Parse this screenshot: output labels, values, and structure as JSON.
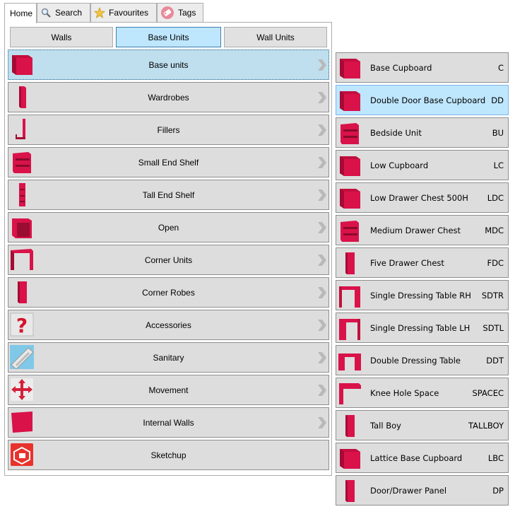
{
  "tabs": [
    {
      "label": "Home",
      "icon": ""
    },
    {
      "label": "Search",
      "icon": "magnifier-icon"
    },
    {
      "label": "Favourites",
      "icon": "star-icon"
    },
    {
      "label": "Tags",
      "icon": "tag-icon"
    }
  ],
  "segments": {
    "walls": "Walls",
    "base_units": "Base Units",
    "wall_units": "Wall Units"
  },
  "categories": [
    {
      "label": "Base units",
      "icon": "base-cabinet-icon"
    },
    {
      "label": "Wardrobes",
      "icon": "wardrobe-icon"
    },
    {
      "label": "Fillers",
      "icon": "filler-icon"
    },
    {
      "label": "Small End Shelf",
      "icon": "small-end-shelf-icon"
    },
    {
      "label": "Tall End Shelf",
      "icon": "tall-end-shelf-icon"
    },
    {
      "label": "Open",
      "icon": "open-unit-icon"
    },
    {
      "label": "Corner Units",
      "icon": "corner-unit-icon"
    },
    {
      "label": "Corner Robes",
      "icon": "corner-robe-icon"
    },
    {
      "label": "Accessories",
      "icon": "question-icon"
    },
    {
      "label": "Sanitary",
      "icon": "sink-icon"
    },
    {
      "label": "Movement",
      "icon": "move-arrows-icon"
    },
    {
      "label": "Internal Walls",
      "icon": "wall-panel-icon"
    },
    {
      "label": "Sketchup",
      "icon": "sketchup-icon"
    }
  ],
  "products": [
    {
      "name": "Base Cupboard",
      "code": "C"
    },
    {
      "name": "Double Door Base Cupboard",
      "code": "DD"
    },
    {
      "name": "Bedside Unit",
      "code": "BU"
    },
    {
      "name": "Low Cupboard",
      "code": "LC"
    },
    {
      "name": "Low Drawer Chest 500H",
      "code": "LDC"
    },
    {
      "name": "Medium Drawer Chest",
      "code": "MDC"
    },
    {
      "name": "Five Drawer Chest",
      "code": "FDC"
    },
    {
      "name": "Single Dressing Table RH",
      "code": "SDTR"
    },
    {
      "name": "Single Dressing Table LH",
      "code": "SDTL"
    },
    {
      "name": "Double Dressing Table",
      "code": "DDT"
    },
    {
      "name": "Knee Hole Space",
      "code": "SPACEC"
    },
    {
      "name": "Tall Boy",
      "code": "TALLBOY"
    },
    {
      "name": "Lattice Base Cupboard",
      "code": "LBC"
    },
    {
      "name": "Door/Drawer Panel",
      "code": "DP"
    }
  ],
  "colors": {
    "unit_red": "#d21048",
    "selected_blue": "#bee6fd",
    "row_gray": "#dddddd"
  }
}
